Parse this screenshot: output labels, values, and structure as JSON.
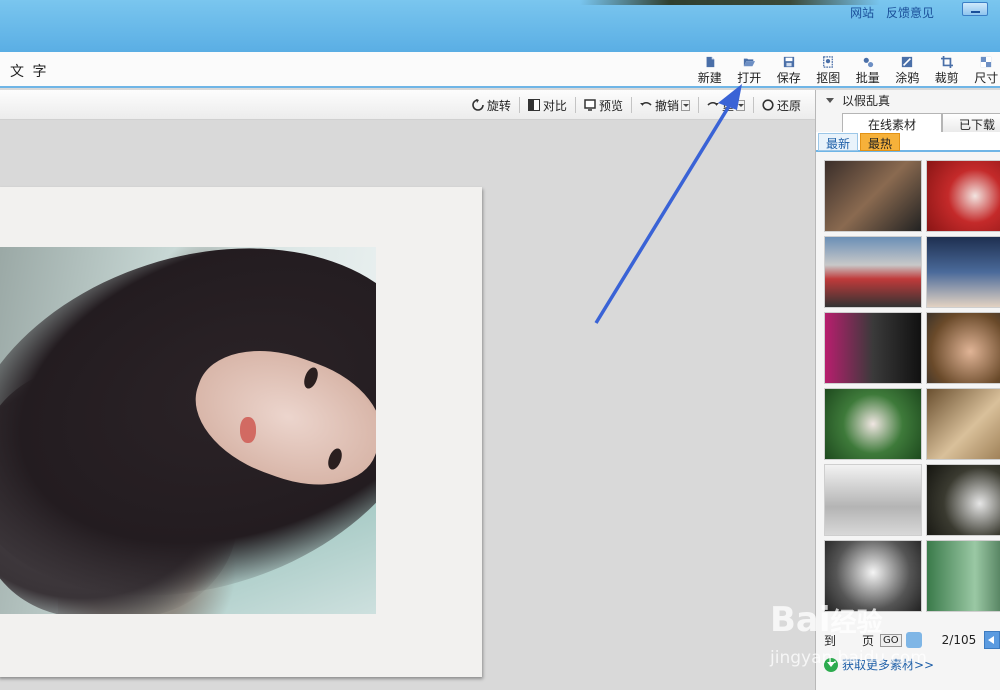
{
  "titlebar": {
    "links": [
      "网站",
      "反馈意见"
    ]
  },
  "menu": {
    "tab_label": "文 字"
  },
  "toolbar": {
    "items": [
      {
        "label": "新建",
        "icon": "new-file-icon"
      },
      {
        "label": "打开",
        "icon": "folder-open-icon"
      },
      {
        "label": "保存",
        "icon": "save-icon"
      },
      {
        "label": "抠图",
        "icon": "cutout-icon"
      },
      {
        "label": "批量",
        "icon": "batch-gear-icon"
      },
      {
        "label": "涂鸦",
        "icon": "paint-icon"
      },
      {
        "label": "裁剪",
        "icon": "crop-icon"
      },
      {
        "label": "尺寸",
        "icon": "resize-icon"
      }
    ]
  },
  "subtoolbar": {
    "rotate": "旋转",
    "compare": "对比",
    "preview": "预览",
    "undo": "撤销",
    "redo": "重",
    "restore": "还原"
  },
  "panel": {
    "section_title": "以假乱真",
    "tabs": [
      "在线素材",
      "已下载"
    ],
    "subtabs": [
      "最新",
      "最热"
    ],
    "pager": {
      "to_label": "到",
      "page_label": "页",
      "go_label": "GO",
      "page_count": "2/105"
    },
    "more_link": "获取更多素材>>"
  },
  "watermark": {
    "brand": "Bai",
    "brand_cn": "经验",
    "site": "jingyan.baidu.com"
  },
  "colors": {
    "titlebar": "#6bbbe9",
    "accent": "#6fb5e6",
    "arrow": "#3a63d6",
    "hot_tab": "#f6b13a"
  }
}
